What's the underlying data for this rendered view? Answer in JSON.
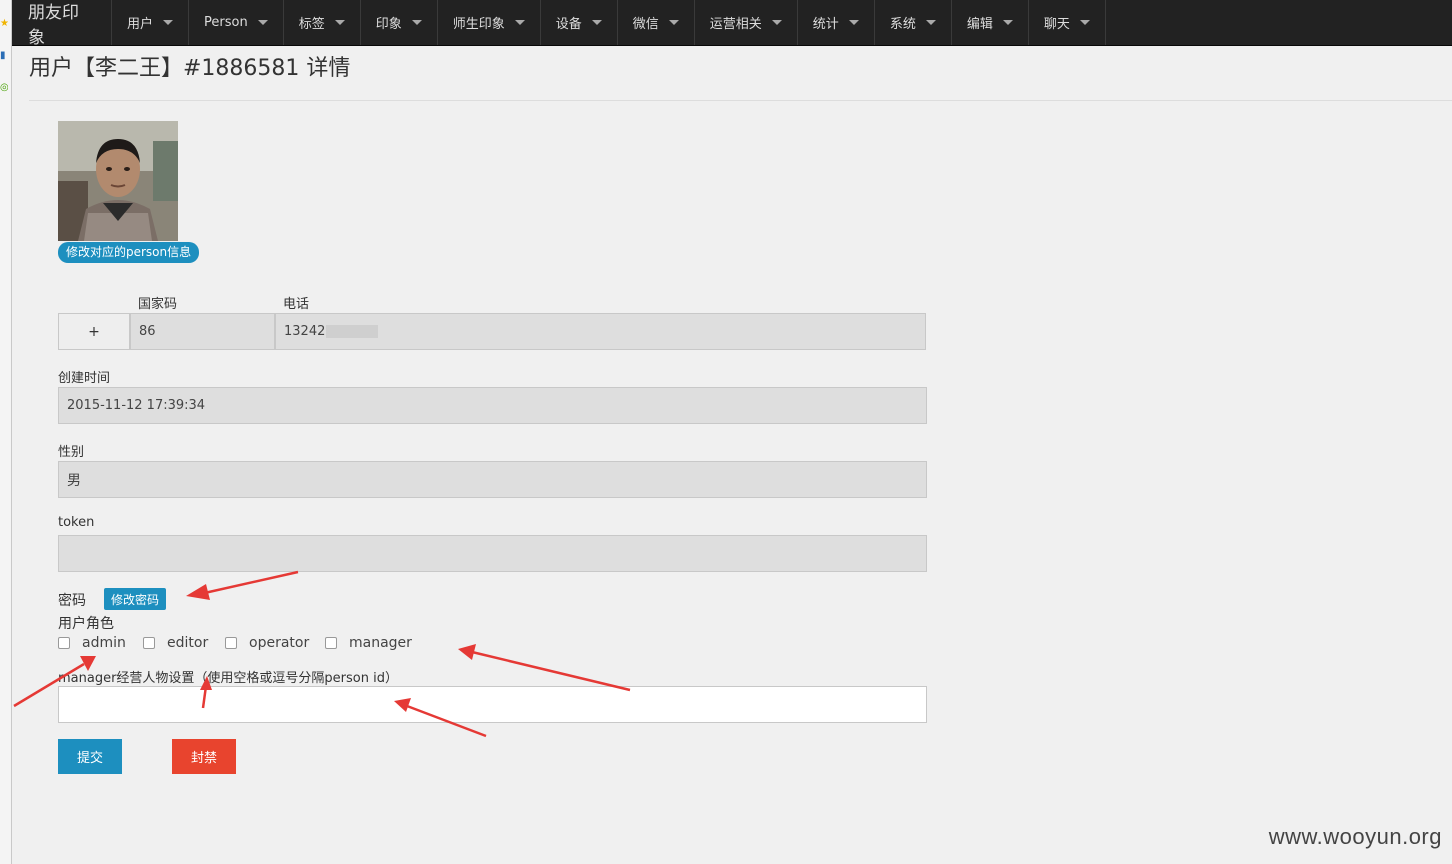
{
  "navbar": {
    "brand": "朋友印象",
    "items": [
      {
        "label": "用户"
      },
      {
        "label": "Person"
      },
      {
        "label": "标签"
      },
      {
        "label": "印象"
      },
      {
        "label": "师生印象"
      },
      {
        "label": "设备"
      },
      {
        "label": "微信"
      },
      {
        "label": "运营相关"
      },
      {
        "label": "统计"
      },
      {
        "label": "系统"
      },
      {
        "label": "编辑"
      },
      {
        "label": "聊天"
      }
    ]
  },
  "page": {
    "title": "用户【李二王】#1886581 详情",
    "edit_person_label": "修改对应的person信息"
  },
  "form": {
    "country_code_label": "国家码",
    "phone_label": "电话",
    "plus_addon": "+",
    "country_code_value": "86",
    "phone_value": "13242",
    "created_label": "创建时间",
    "created_value": "2015-11-12 17:39:34",
    "gender_label": "性别",
    "gender_value": "男",
    "token_label": "token",
    "token_value": "",
    "password_label": "密码",
    "change_password_label": "修改密码",
    "roles_label": "用户角色",
    "roles": [
      {
        "label": "admin",
        "checked": false
      },
      {
        "label": "editor",
        "checked": false
      },
      {
        "label": "operator",
        "checked": false
      },
      {
        "label": "manager",
        "checked": false
      }
    ],
    "manager_label": "manager经营人物设置（使用空格或逗号分隔person id）",
    "manager_value": "",
    "submit_label": "提交",
    "ban_label": "封禁"
  },
  "watermark": "www.wooyun.org",
  "colors": {
    "navbar_bg": "#222222",
    "primary": "#1d8fbf",
    "danger": "#e8442e",
    "annotation_arrow": "#e53935"
  }
}
